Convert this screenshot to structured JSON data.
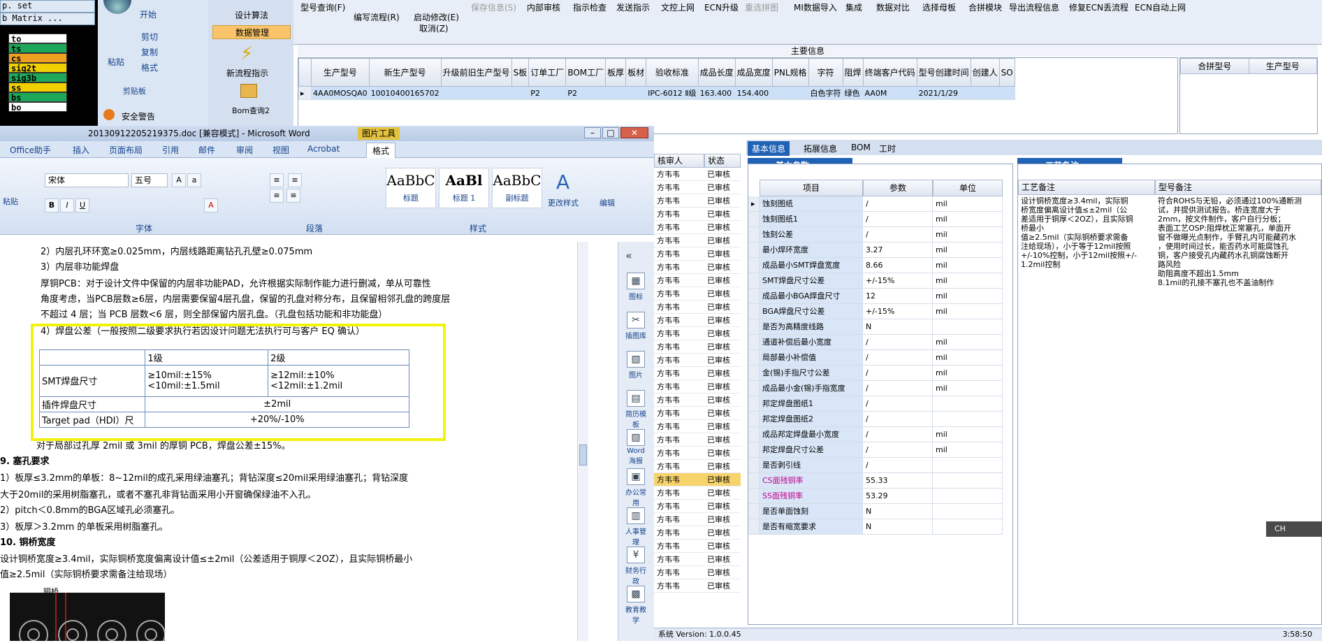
{
  "matrix": {
    "title1": "p. set",
    "title2": "b Matrix ...",
    "items": [
      {
        "label": "to",
        "color": "#ffffff"
      },
      {
        "label": "ts",
        "color": "#1ea85a"
      },
      {
        "label": "cs",
        "color": "#f0a020"
      },
      {
        "label": "sig2t",
        "color": "#f0d000"
      },
      {
        "label": "sig3b",
        "color": "#1ea85a"
      },
      {
        "label": "ss",
        "color": "#f0d000"
      },
      {
        "label": "bs",
        "color": "#1ea85a"
      },
      {
        "label": "bo",
        "color": "#ffffff"
      }
    ]
  },
  "left_ribbon": {
    "start_tab": "开始",
    "cut": "剪切",
    "copy": "复制",
    "paste": "粘贴",
    "format": "格式",
    "clipboard_group": "剪贴板",
    "security": "安全警告"
  },
  "menu_panel": {
    "items": [
      "设计算法",
      "数据管理"
    ],
    "new_flow": "新流程指示",
    "bom_query": "Bom查询2"
  },
  "toolbar": {
    "buttons": [
      {
        "label": "型号查询(F)",
        "disabled": false
      },
      {
        "label": "编写流程(R)",
        "disabled": false
      },
      {
        "label": "启动修改(E)",
        "disabled": false
      },
      {
        "label": "取消(Z)",
        "disabled": false
      },
      {
        "label": "保存信息(S)",
        "disabled": true
      },
      {
        "label": "内部审核",
        "disabled": false
      },
      {
        "label": "指示检查",
        "disabled": false
      },
      {
        "label": "发送指示",
        "disabled": false
      },
      {
        "label": "文控上网",
        "disabled": false
      },
      {
        "label": "ECN升级",
        "disabled": false
      },
      {
        "label": "重选拼图",
        "disabled": true
      },
      {
        "label": "MI数据导入",
        "disabled": false
      },
      {
        "label": "集成",
        "disabled": false
      },
      {
        "label": "数据对比",
        "disabled": false
      },
      {
        "label": "选择母板",
        "disabled": false
      },
      {
        "label": "合拼模块",
        "disabled": false
      },
      {
        "label": "导出流程信息",
        "disabled": false
      },
      {
        "label": "修复ECN丢流程",
        "disabled": false
      },
      {
        "label": "ECN自动上网",
        "disabled": false
      }
    ]
  },
  "main_info": {
    "title": "主要信息",
    "columns": [
      "生产型号",
      "新生产型号",
      "升级前旧生产型号",
      "S板",
      "订单工厂",
      "BOM工厂",
      "板厚",
      "板材",
      "验收标准",
      "成品长度",
      "成品宽度",
      "PNL规格",
      "字符",
      "阻焊",
      "终端客户代码",
      "型号创建时间",
      "创建人",
      "SO"
    ],
    "row": [
      "4AA0MOSQA0",
      "10010400165702",
      "",
      "",
      "P2",
      "P2",
      "",
      "",
      "IPC-6012 Ⅱ级",
      "163.400",
      "154.400",
      "",
      "白色字符",
      "绿色",
      "AA0M",
      "2021/1/29",
      "",
      ""
    ],
    "side_columns": [
      "合拼型号",
      "生产型号"
    ]
  },
  "word": {
    "title": "20130912205219375.doc [兼容模式] - Microsoft Word",
    "context": "图片工具",
    "tabs": [
      "Office助手",
      "插入",
      "页面布局",
      "引用",
      "邮件",
      "审阅",
      "视图",
      "Acrobat",
      "格式"
    ],
    "font_name": "宋体",
    "font_size": "五号",
    "groups": [
      "粘贴",
      "字体",
      "段落",
      "样式",
      "编辑"
    ],
    "styles": [
      {
        "sample": "AaBbC",
        "name": "标题"
      },
      {
        "sample": "AaBl",
        "name": "标题 1"
      },
      {
        "sample": "AaBbC",
        "name": "副标题"
      }
    ],
    "change_styles": "更改样式",
    "edit": "编辑",
    "side_icons": [
      "图标",
      "插图库",
      "图片",
      "简历模板",
      "Word海报",
      "办公常用",
      "人事管理",
      "财务行政",
      "教育教学"
    ]
  },
  "doc": {
    "lines": [
      "2）内层孔环环宽≥0.025mm，内层线路距离钻孔孔壁≥0.075mm",
      "3）内层非功能焊盘",
      "厚铜PCB：对于设计文件中保留的内层非功能PAD，允许根据实际制作能力进行删减，单从可靠性",
      "角度考虑，当PCB层数≥6层，内层需要保留4层孔盘，保留的孔盘对称分布，且保留相邻孔盘的跨度层",
      "不超过 4 层；当 PCB 层数<6 层，则全部保留内层孔盘。（孔盘包括功能和非功能盘）",
      "4）焊盘公差（一般按照二级要求执行若因设计问题无法执行可与客户 EQ 确认）",
      "对于局部过孔厚 2mil 或 3mil 的厚铜 PCB，焊盘公差±15%。",
      "9. 塞孔要求",
      "1）板厚≤3.2mm的单板：8~12mil的成孔采用绿油塞孔；背钻深度≤20mil采用绿油塞孔；背钻深度",
      "大于20mil的采用树脂塞孔，或者不塞孔非背钻面采用小开窗确保绿油不入孔。",
      "2）pitch＜0.8mm的BGA区域孔必须塞孔。",
      "3）板厚＞3.2mm 的单板采用树脂塞孔。",
      "10. 铜桥宽度",
      "设计铜桥宽度≥3.4mil，实际铜桥宽度偏离设计值≤±2mil（公差适用于铜厚＜2OZ），且实际铜桥最小",
      "值≥2.5mil（实际铜桥要求需备注给现场）",
      "铜桥"
    ],
    "table": {
      "h1": "1级",
      "h2": "2级",
      "r1_label": "SMT焊盘尺寸",
      "r1_c1a": "≥10mil:±15%",
      "r1_c1b": "<10mil:±1.5mil",
      "r1_c2a": "≥12mil:±10%",
      "r1_c2b": "<12mil:±1.2mil",
      "r2_label": "插件焊盘尺寸",
      "r2_val": "±2mil",
      "r3_label": "Target pad（HDI）尺",
      "r3_val": "+20%/-10%"
    }
  },
  "middle_list": {
    "col1": "核审人",
    "col2": "状态",
    "rows": [
      "方韦韦|已审核",
      "方韦韦|已审核",
      "方韦韦|已审核",
      "方韦韦|已审核",
      "方韦韦|已审核",
      "方韦韦|已审核",
      "方韦韦|已审核",
      "方韦韦|已审核",
      "方韦韦|已审核",
      "方韦韦|已审核",
      "方韦韦|已审核",
      "方韦韦|已审核",
      "方韦韦|已审核",
      "方韦韦|已审核",
      "方韦韦|已审核",
      "方韦韦|已审核",
      "方韦韦|已审核",
      "方韦韦|已审核",
      "方韦韦|已审核",
      "方韦韦|已审核",
      "方韦韦|已审核",
      "方韦韦|已审核",
      "方韦韦|已审核",
      "方韦韦|已审核",
      "方韦韦|已审核",
      "方韦韦|已审核",
      "方韦韦|已审核",
      "方韦韦|已审核",
      "方韦韦|已审核",
      "方韦韦|已审核",
      "方韦韦|已审核",
      "方韦韦|已审核"
    ]
  },
  "right_tabs": [
    "基本信息",
    "拓展信息",
    "BOM",
    "工时"
  ],
  "params": {
    "section": "基本参数",
    "columns": [
      "项目",
      "参数",
      "单位"
    ],
    "rows": [
      {
        "name": "蚀刻图纸",
        "value": "/",
        "unit": "mil",
        "accent": false
      },
      {
        "name": "蚀刻图纸1",
        "value": "/",
        "unit": "mil",
        "accent": false
      },
      {
        "name": "蚀刻公差",
        "value": "/",
        "unit": "mil",
        "accent": false
      },
      {
        "name": "最小焊环宽度",
        "value": "3.27",
        "unit": "mil",
        "accent": false
      },
      {
        "name": "成品最小SMT焊盘宽度",
        "value": "8.66",
        "unit": "mil",
        "accent": false
      },
      {
        "name": "SMT焊盘尺寸公差",
        "value": "+/-15%",
        "unit": "mil",
        "accent": false
      },
      {
        "name": "成品最小BGA焊盘尺寸",
        "value": "12",
        "unit": "mil",
        "accent": false
      },
      {
        "name": "BGA焊盘尺寸公差",
        "value": "+/-15%",
        "unit": "mil",
        "accent": false
      },
      {
        "name": "是否为高精度线路",
        "value": "N",
        "unit": "",
        "accent": false
      },
      {
        "name": "通道补偿后最小宽度",
        "value": "/",
        "unit": "mil",
        "accent": false
      },
      {
        "name": "局部最小补偿值",
        "value": "/",
        "unit": "mil",
        "accent": false
      },
      {
        "name": "金(锡)手指尺寸公差",
        "value": "/",
        "unit": "mil",
        "accent": false
      },
      {
        "name": "成品最小金(锡)手指宽度",
        "value": "/",
        "unit": "mil",
        "accent": false
      },
      {
        "name": "邦定焊盘图纸1",
        "value": "/",
        "unit": "",
        "accent": false
      },
      {
        "name": "邦定焊盘图纸2",
        "value": "/",
        "unit": "",
        "accent": false
      },
      {
        "name": "成品邦定焊盘最小宽度",
        "value": "/",
        "unit": "mil",
        "accent": false
      },
      {
        "name": "邦定焊盘尺寸公差",
        "value": "/",
        "unit": "mil",
        "accent": false
      },
      {
        "name": "是否剥引线",
        "value": "/",
        "unit": "",
        "accent": false
      },
      {
        "name": "CS面残铜率",
        "value": "55.33",
        "unit": "",
        "accent": true
      },
      {
        "name": "SS面残铜率",
        "value": "53.29",
        "unit": "",
        "accent": true
      },
      {
        "name": "是否单面蚀刻",
        "value": "N",
        "unit": "",
        "accent": false
      },
      {
        "name": "是否有缩宽要求",
        "value": "N",
        "unit": "",
        "accent": false
      }
    ]
  },
  "notes": {
    "section": "工艺备注",
    "col1": "工艺备注",
    "col2": "型号备注",
    "text1": "设计铜桥宽度≥3.4mil，实际铜\n桥宽度偏离设计值≤±2mil（公\n差适用于铜厚＜2OZ），且实际铜\n桥最小\n值≥2.5mil（实际铜桥要求需备\n注给现场），小于等于12mil按照\n+/-10%控制，小于12mil按照+/-\n1.2mil控制",
    "text2": "符合ROHS与无铅，必须通过100%通断测\n试，并提供测试报告。桥连宽度大于\n2mm，按文件制作，客户自行分板；\n表面工艺OSP:阻焊枕正常塞孔，单面开\n窗不做曝光点制作，手臂孔内可能藏药水\n，使用时间过长，能否药水可能腐蚀孔\n铜，客户接受孔内藏药水孔铜腐蚀断开\n路风险\n助阻高度不超出1.5mm\n8.1mil的孔接不塞孔也不盖油制作"
  },
  "status": {
    "version": "系统 Version: 1.0.0.45",
    "clock": "3:58:50"
  },
  "ime": {
    "label": "CH"
  },
  "colors": {
    "accent": "#1f62b6",
    "highlight": "#f2f20c",
    "accent_text": "#c0008c"
  }
}
